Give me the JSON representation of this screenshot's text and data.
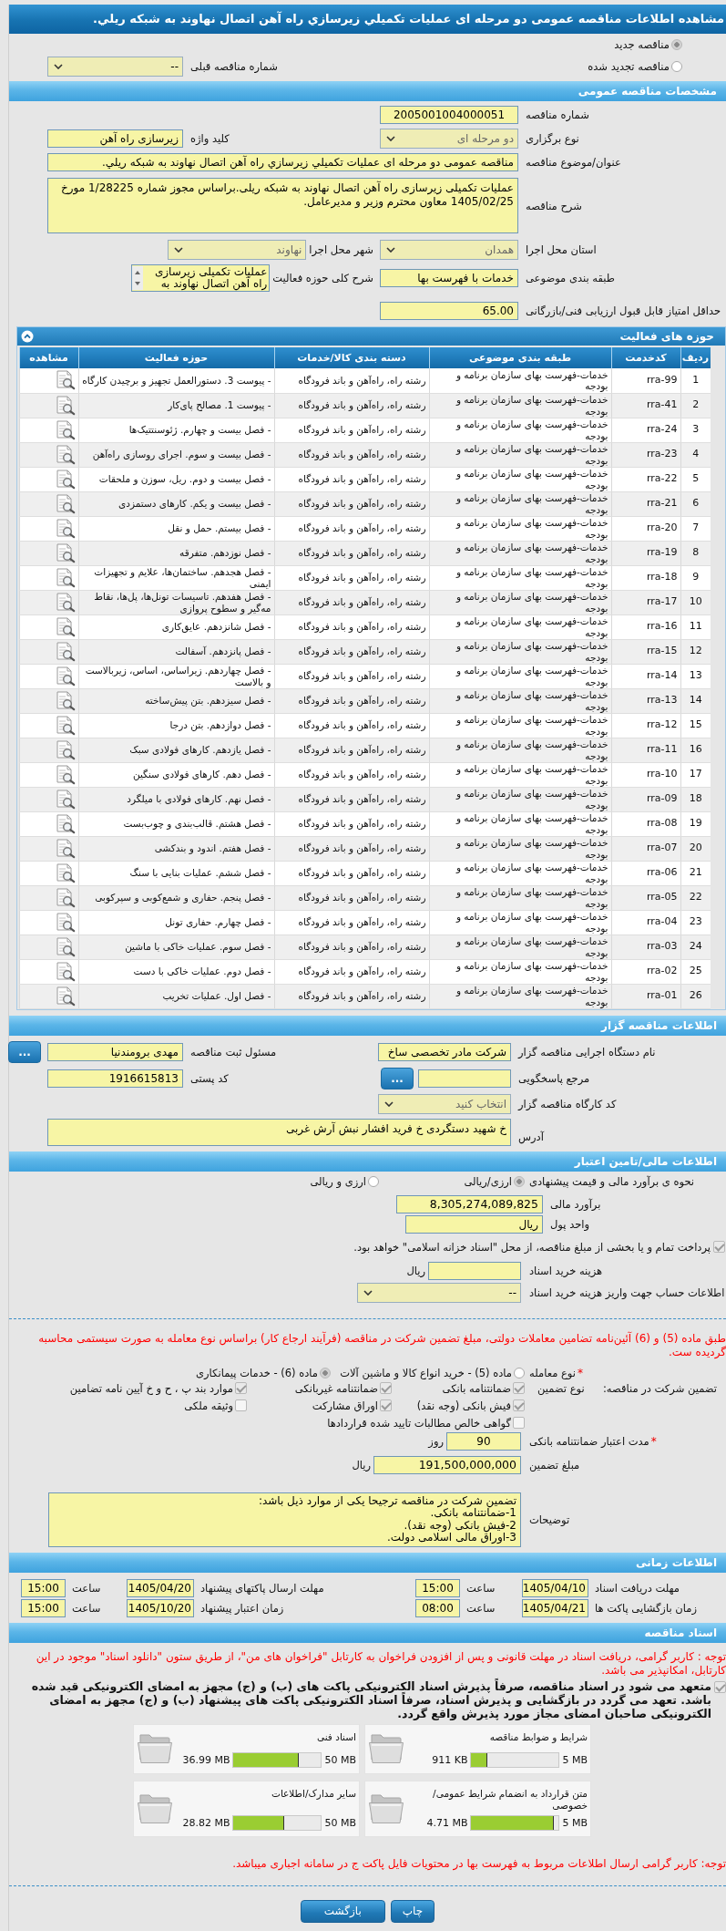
{
  "page_title": "مشاهده اطلاعات مناقصه عمومی دو مرحله ای عملیات تکمیلي زیرسازي راه آهن اتصال نهاوند به شبکه ریلي.",
  "tender_status": {
    "options": [
      {
        "label": "مناقصه جدید",
        "selected": true
      },
      {
        "label": "مناقصه تجدید شده",
        "selected": false
      }
    ],
    "previous_tender": {
      "label": "شماره مناقصه قبلی",
      "value": "--"
    }
  },
  "general": {
    "heading": "مشخصات مناقصه عمومی",
    "tender_number": {
      "label": "شماره مناقصه",
      "value": "2005001004000051"
    },
    "holding_type": {
      "label": "نوع برگزاری",
      "value": "دو مرحله ای"
    },
    "keyword": {
      "label": "کلید واژه",
      "value": "زیرسازی راه آهن"
    },
    "subject": {
      "label": "عنوان/موضوع مناقصه",
      "value": "مناقصه عمومی دو مرحله ای عملیات تکمیلي زیرسازي راه آهن اتصال نهاوند به شبکه ریلي."
    },
    "description": {
      "label": "شرح مناقصه",
      "value": "عملیات تکمیلی زیرسازی راه آهن اتصال نهاوند به شبکه ریلی.براساس مجوز شماره 1/28225 مورخ 1405/02/25 معاون محترم وزیر و مدیرعامل."
    },
    "province": {
      "label": "استان محل اجرا",
      "value": "همدان"
    },
    "city": {
      "label": "شهر محل اجرا",
      "value": "نهاوند"
    },
    "subject_class": {
      "label": "طبقه بندی موضوعی",
      "value": "خدمات با فهرست بها"
    },
    "activity_summary": {
      "label": "شرح کلی حوزه فعالیت",
      "value": "عملیات تکمیلی زیرسازی راه آهن اتصال نهاوند به"
    },
    "min_score": {
      "label": "حداقل امتیاز قابل قبول ارزیابی فنی/بازرگانی",
      "value": "65.00"
    }
  },
  "activities": {
    "heading": "حوزه های فعالیت",
    "columns": [
      "ردیف",
      "کدخدمت",
      "طبقه بندی موضوعی",
      "دسته بندی کالا/خدمات",
      "حوزه فعالیت",
      "مشاهده"
    ],
    "rows": [
      {
        "row": "1",
        "code": "rra-99",
        "classification": "خدمات-فهرست بهای سازمان برنامه و بودجه",
        "category": "رشته راه، راه‌آهن و باند فرودگاه",
        "activity": "- پیوست 3. دستورالعمل تجهیز و برچیدن کارگاه"
      },
      {
        "row": "2",
        "code": "rra-41",
        "classification": "خدمات-فهرست بهای سازمان برنامه و بودجه",
        "category": "رشته راه، راه‌آهن و باند فرودگاه",
        "activity": "- پیوست 1. مصالح پای‌کار"
      },
      {
        "row": "3",
        "code": "rra-24",
        "classification": "خدمات-فهرست بهای سازمان برنامه و بودجه",
        "category": "رشته راه، راه‌آهن و باند فرودگاه",
        "activity": "- فصل بیست و چهارم. ژئوسنتتیک‌ها"
      },
      {
        "row": "4",
        "code": "rra-23",
        "classification": "خدمات-فهرست بهای سازمان برنامه و بودجه",
        "category": "رشته راه، راه‌آهن و باند فرودگاه",
        "activity": "- فصل بیست و سوم. اجرای روسازی راه‌آهن"
      },
      {
        "row": "5",
        "code": "rra-22",
        "classification": "خدمات-فهرست بهای سازمان برنامه و بودجه",
        "category": "رشته راه، راه‌آهن و باند فرودگاه",
        "activity": "- فصل بیست و دوم. ریل، سوزن و ملحقات"
      },
      {
        "row": "6",
        "code": "rra-21",
        "classification": "خدمات-فهرست بهای سازمان برنامه و بودجه",
        "category": "رشته راه، راه‌آهن و باند فرودگاه",
        "activity": "- فصل بیست و یکم. کارهای دستمزدی"
      },
      {
        "row": "7",
        "code": "rra-20",
        "classification": "خدمات-فهرست بهای سازمان برنامه و بودجه",
        "category": "رشته راه، راه‌آهن و باند فرودگاه",
        "activity": "- فصل بیستم. حمل و نقل"
      },
      {
        "row": "8",
        "code": "rra-19",
        "classification": "خدمات-فهرست بهای سازمان برنامه و بودجه",
        "category": "رشته راه، راه‌آهن و باند فرودگاه",
        "activity": "- فصل نوزدهم. متفرقه"
      },
      {
        "row": "9",
        "code": "rra-18",
        "classification": "خدمات-فهرست بهای سازمان برنامه و بودجه",
        "category": "رشته راه، راه‌آهن و باند فرودگاه",
        "activity": "- فصل هجدهم. ساختمان‌ها، علایم و تجهیزات ایمنی"
      },
      {
        "row": "10",
        "code": "rra-17",
        "classification": "خدمات-فهرست بهای سازمان برنامه و بودجه",
        "category": "رشته راه، راه‌آهن و باند فرودگاه",
        "activity": "- فصل هفدهم. تاسیسات تونل‌ها، پل‌ها، نقاط مه‌گیر و سطوح پروازی"
      },
      {
        "row": "11",
        "code": "rra-16",
        "classification": "خدمات-فهرست بهای سازمان برنامه و بودجه",
        "category": "رشته راه، راه‌آهن و باند فرودگاه",
        "activity": "- فصل شانزدهم. عایق‌کاری"
      },
      {
        "row": "12",
        "code": "rra-15",
        "classification": "خدمات-فهرست بهای سازمان برنامه و بودجه",
        "category": "رشته راه، راه‌آهن و باند فرودگاه",
        "activity": "- فصل پانزدهم. آسفالت"
      },
      {
        "row": "13",
        "code": "rra-14",
        "classification": "خدمات-فهرست بهای سازمان برنامه و بودجه",
        "category": "رشته راه، راه‌آهن و باند فرودگاه",
        "activity": "- فصل چهاردهم. زیراساس، اساس، زیربالاست و بالاست"
      },
      {
        "row": "14",
        "code": "rra-13",
        "classification": "خدمات-فهرست بهای سازمان برنامه و بودجه",
        "category": "رشته راه، راه‌آهن و باند فرودگاه",
        "activity": "- فصل سیزدهم. بتن پیش‌ساخته"
      },
      {
        "row": "15",
        "code": "rra-12",
        "classification": "خدمات-فهرست بهای سازمان برنامه و بودجه",
        "category": "رشته راه، راه‌آهن و باند فرودگاه",
        "activity": "- فصل دوازدهم. بتن درجا"
      },
      {
        "row": "16",
        "code": "rra-11",
        "classification": "خدمات-فهرست بهای سازمان برنامه و بودجه",
        "category": "رشته راه، راه‌آهن و باند فرودگاه",
        "activity": "- فصل یازدهم. کارهای فولادی سبک"
      },
      {
        "row": "17",
        "code": "rra-10",
        "classification": "خدمات-فهرست بهای سازمان برنامه و بودجه",
        "category": "رشته راه، راه‌آهن و باند فرودگاه",
        "activity": "- فصل دهم. کارهای فولادی سنگین"
      },
      {
        "row": "18",
        "code": "rra-09",
        "classification": "خدمات-فهرست بهای سازمان برنامه و بودجه",
        "category": "رشته راه، راه‌آهن و باند فرودگاه",
        "activity": "- فصل نهم. کارهای فولادی با میلگرد"
      },
      {
        "row": "19",
        "code": "rra-08",
        "classification": "خدمات-فهرست بهای سازمان برنامه و بودجه",
        "category": "رشته راه، راه‌آهن و باند فرودگاه",
        "activity": "- فصل هشتم. قالب‌بندی و چوب‌بست"
      },
      {
        "row": "20",
        "code": "rra-07",
        "classification": "خدمات-فهرست بهای سازمان برنامه و بودجه",
        "category": "رشته راه، راه‌آهن و باند فرودگاه",
        "activity": "- فصل هفتم. اندود و بندکشی"
      },
      {
        "row": "21",
        "code": "rra-06",
        "classification": "خدمات-فهرست بهای سازمان برنامه و بودجه",
        "category": "رشته راه، راه‌آهن و باند فرودگاه",
        "activity": "- فصل ششم. عملیات بنایی با سنگ"
      },
      {
        "row": "22",
        "code": "rra-05",
        "classification": "خدمات-فهرست بهای سازمان برنامه و بودجه",
        "category": "رشته راه، راه‌آهن و باند فرودگاه",
        "activity": "- فصل پنجم. حفاری و شمع‌کوبی و سپرکوبی"
      },
      {
        "row": "23",
        "code": "rra-04",
        "classification": "خدمات-فهرست بهای سازمان برنامه و بودجه",
        "category": "رشته راه، راه‌آهن و باند فرودگاه",
        "activity": "- فصل چهارم. حفاری تونل"
      },
      {
        "row": "24",
        "code": "rra-03",
        "classification": "خدمات-فهرست بهای سازمان برنامه و بودجه",
        "category": "رشته راه، راه‌آهن و باند فرودگاه",
        "activity": "- فصل سوم. عملیات خاکی با ماشین"
      },
      {
        "row": "25",
        "code": "rra-02",
        "classification": "خدمات-فهرست بهای سازمان برنامه و بودجه",
        "category": "رشته راه، راه‌آهن و باند فرودگاه",
        "activity": "- فصل دوم. عملیات خاکی با دست"
      },
      {
        "row": "26",
        "code": "rra-01",
        "classification": "خدمات-فهرست بهای سازمان برنامه و بودجه",
        "category": "رشته راه، راه‌آهن و باند فرودگاه",
        "activity": "- فصل اول. عملیات تخریب"
      }
    ]
  },
  "tenderer": {
    "heading": "اطلاعات مناقصه گزار",
    "agency": {
      "label": "نام دستگاه اجرایی مناقصه گزار",
      "value": "شرکت مادر تخصصی ساخ"
    },
    "registrar": {
      "label": "مسئول ثبت مناقصه",
      "value": "مهدی برومندنیا",
      "button": "..."
    },
    "response_ref": {
      "label": "مرجع پاسخگویی",
      "button": "..."
    },
    "postal_code": {
      "label": "کد پستی",
      "value": "1916615813"
    },
    "workshop_code": {
      "label": "کد کارگاه مناقصه گزار",
      "value": "انتخاب کنید"
    },
    "address": {
      "label": "آدرس",
      "value": "خ شهید دستگردی خ فرید افشار نبش آرش غربی"
    }
  },
  "financial": {
    "heading": "اطلاعات مالی/تامین اعتبار",
    "estimate_method": {
      "label": "نحوه ی برآورد مالی و قیمت پیشنهادی",
      "options": [
        {
          "label": "ارزی/ریالی",
          "selected": true
        },
        {
          "label": "ارزی و ریالی",
          "selected": false
        }
      ]
    },
    "estimate": {
      "label": "برآورد مالی",
      "value": "8,305,274,089,825"
    },
    "currency": {
      "label": "واحد پول",
      "value": "ریال"
    },
    "treasury": {
      "label": "پرداخت تمام و یا بخشی از مبلغ مناقصه، از محل \"اسناد خزانه اسلامی\" خواهد بود.",
      "checked": true
    },
    "document_fee": {
      "label": "هزینه خرید اسناد",
      "unit": "ریال"
    },
    "fee_account": {
      "label": "اطلاعات حساب جهت واریز هزینه خرید اسناد",
      "value": "--"
    }
  },
  "guarantee": {
    "notice": "طبق ماده (5) و (6) آئین‌نامه تضامین معاملات دولتی، مبلغ تضمین شرکت در مناقصه (فرآیند ارجاع کار) براساس نوع معامله به صورت سیستمی محاسبه گردیده ست.",
    "deal_type": {
      "mark": "*",
      "label": "نوع معامله",
      "options": [
        {
          "label": "ماده (5) - خرید انواع کالا و ماشین آلات",
          "selected": false
        },
        {
          "label": "ماده (6) - خدمات پیمانکاری",
          "selected": true
        }
      ]
    },
    "participation_label": "تضمین شرکت در مناقصه:",
    "type_label": "نوع تضمین",
    "types": [
      {
        "label": "ضمانتنامه بانکی",
        "checked": true
      },
      {
        "label": "ضمانتنامه غیربانکی",
        "checked": true
      },
      {
        "label": "موارد بند پ ، ح و خ آیین نامه تضامین",
        "checked": true
      },
      {
        "label": "فیش بانکی (وجه نقد)",
        "checked": true
      },
      {
        "label": "اوراق مشارکت",
        "checked": true
      },
      {
        "label": "وثیقه ملکی",
        "checked": false
      },
      {
        "label": "گواهی خالص مطالبات تایید شده قراردادها",
        "checked": false
      }
    ],
    "validity": {
      "mark": "*",
      "label": "مدت اعتبار ضمانتنامه بانکی",
      "value": "90",
      "unit": "روز"
    },
    "amount": {
      "label": "مبلغ تضمین",
      "value": "191,500,000,000",
      "unit": "ریال"
    },
    "notes": {
      "label": "توضیحات",
      "value": "تضمین شرکت در مناقصه ترجیحا یکی از موارد ذیل باشد:\n1-ضمانتنامه بانکی.\n2-فیش بانکی (وجه نقد).\n3-اوراق مالی اسلامی دولت."
    }
  },
  "timing": {
    "heading": "اطلاعات زمانی",
    "items": [
      {
        "label": "مهلت دریافت اسناد",
        "date": "1405/04/10",
        "time_label": "ساعت",
        "time": "15:00"
      },
      {
        "label": "مهلت ارسال پاکتهای پیشنهاد",
        "date": "1405/04/20",
        "time_label": "ساعت",
        "time": "15:00"
      },
      {
        "label": "زمان بازگشایی پاکت ها",
        "date": "1405/04/21",
        "time_label": "ساعت",
        "time": "08:00"
      },
      {
        "label": "زمان اعتبار پیشنهاد",
        "date": "1405/10/20",
        "time_label": "ساعت",
        "time": "15:00"
      }
    ]
  },
  "documents": {
    "heading": "اسناد مناقصه",
    "notice": "توجه : کاربر گرامی، دریافت اسناد در مهلت قانونی و پس از افزودن فراخوان به کارتابل \"فراخوان های من\"، از طریق ستون \"دانلود اسناد\" موجود در این کارتابل، امکانپذیر می باشد.",
    "commitment": {
      "text": "متعهد می شود در اسناد مناقصه، صرفاً پذیرش اسناد الکترونیکی پاکت های (ب) و (ج) مجهز به امضای الکترونیکی قید شده باشد. تعهد می گردد در بازگشایی و پذیرش اسناد، صرفاً اسناد الکترونیکی پاکت های پیشنهاد (ب) و (ج) مجهز به امضای الکترونیکی صاحبان امضای مجاز مورد پذیرش واقع گردد.",
      "checked": true
    },
    "files": [
      {
        "title": "شرایط و ضوابط مناقصه",
        "max": "5 MB",
        "used": "911 KB",
        "level": 0.18
      },
      {
        "title": "اسناد فنی",
        "max": "50 MB",
        "used": "36.99 MB",
        "level": 0.74
      },
      {
        "title": "متن قرارداد به انضمام شرایط عمومی/خصوصی",
        "max": "5 MB",
        "used": "4.71 MB",
        "level": 0.94
      },
      {
        "title": "سایر مدارک/اطلاعات",
        "max": "50 MB",
        "used": "28.82 MB",
        "level": 0.58
      }
    ],
    "footer_notice": "توجه: کاربر گرامی ارسال اطلاعات مربوط به فهرست بها در محتویات فایل پاکت ج در سامانه اجباری میباشد."
  },
  "actions": [
    "چاپ",
    "بازگشت"
  ]
}
